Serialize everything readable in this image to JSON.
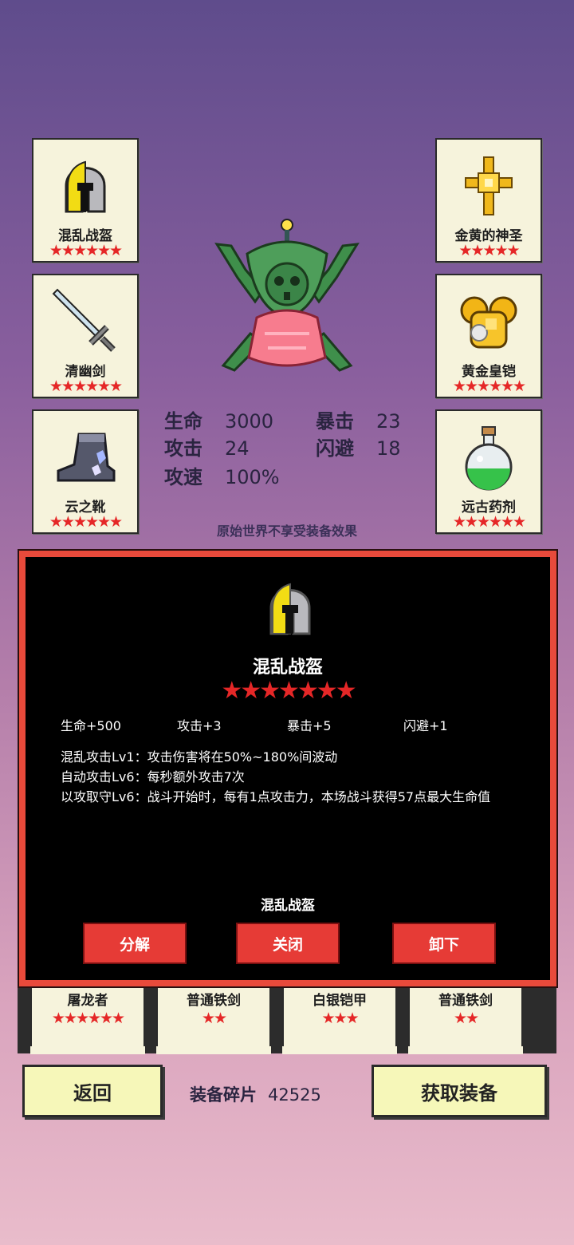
{
  "slots_left": [
    {
      "name": "混乱战盔",
      "stars": "★★★★★★",
      "icon": "helmet-icon"
    },
    {
      "name": "清幽剑",
      "stars": "★★★★★★",
      "icon": "sword-icon"
    },
    {
      "name": "云之靴",
      "stars": "★★★★★★",
      "icon": "boots-icon"
    }
  ],
  "slots_right": [
    {
      "name": "金黄的神圣",
      "stars": "★★★★★",
      "icon": "golden-cross-icon"
    },
    {
      "name": "黄金皇铠",
      "stars": "★★★★★★",
      "icon": "golden-armor-icon"
    },
    {
      "name": "远古药剂",
      "stars": "★★★★★★",
      "icon": "potion-icon"
    }
  ],
  "stats": {
    "hp_label": "生命",
    "hp": "3000",
    "crit_label": "暴击",
    "crit": "23",
    "atk_label": "攻击",
    "atk": "24",
    "dodge_label": "闪避",
    "dodge": "18",
    "speed_label": "攻速",
    "speed": "100%"
  },
  "note": "原始世界不享受装备效果",
  "inventory": [
    {
      "name": "屠龙者",
      "stars": "★★★★★★"
    },
    {
      "name": "普通铁剑",
      "stars": "★★"
    },
    {
      "name": "白银铠甲",
      "stars": "★★★"
    },
    {
      "name": "普通铁剑",
      "stars": "★★"
    }
  ],
  "panel": {
    "title": "混乱战盔",
    "stars": "★★★★★★★",
    "attrs": [
      "生命+500",
      "攻击+3",
      "暴击+5",
      "闪避+1"
    ],
    "desc": [
      "混乱攻击Lv1：攻击伤害将在50%~180%间波动",
      "自动攻击Lv6：每秒额外攻击7次",
      "以攻取守Lv6：战斗开始时，每有1点攻击力，本场战斗获得57点最大生命值"
    ],
    "footer_name": "混乱战盔",
    "buttons": {
      "decompose": "分解",
      "close": "关闭",
      "unequip": "卸下"
    }
  },
  "bottom": {
    "back": "返回",
    "fragments_label": "装备碎片",
    "fragments": "42525",
    "get": "获取装备"
  },
  "colors": {
    "star": "#e52727",
    "panel_border": "#e84a3b",
    "button": "#e63b36",
    "slot_bg": "#f6f3dc"
  }
}
